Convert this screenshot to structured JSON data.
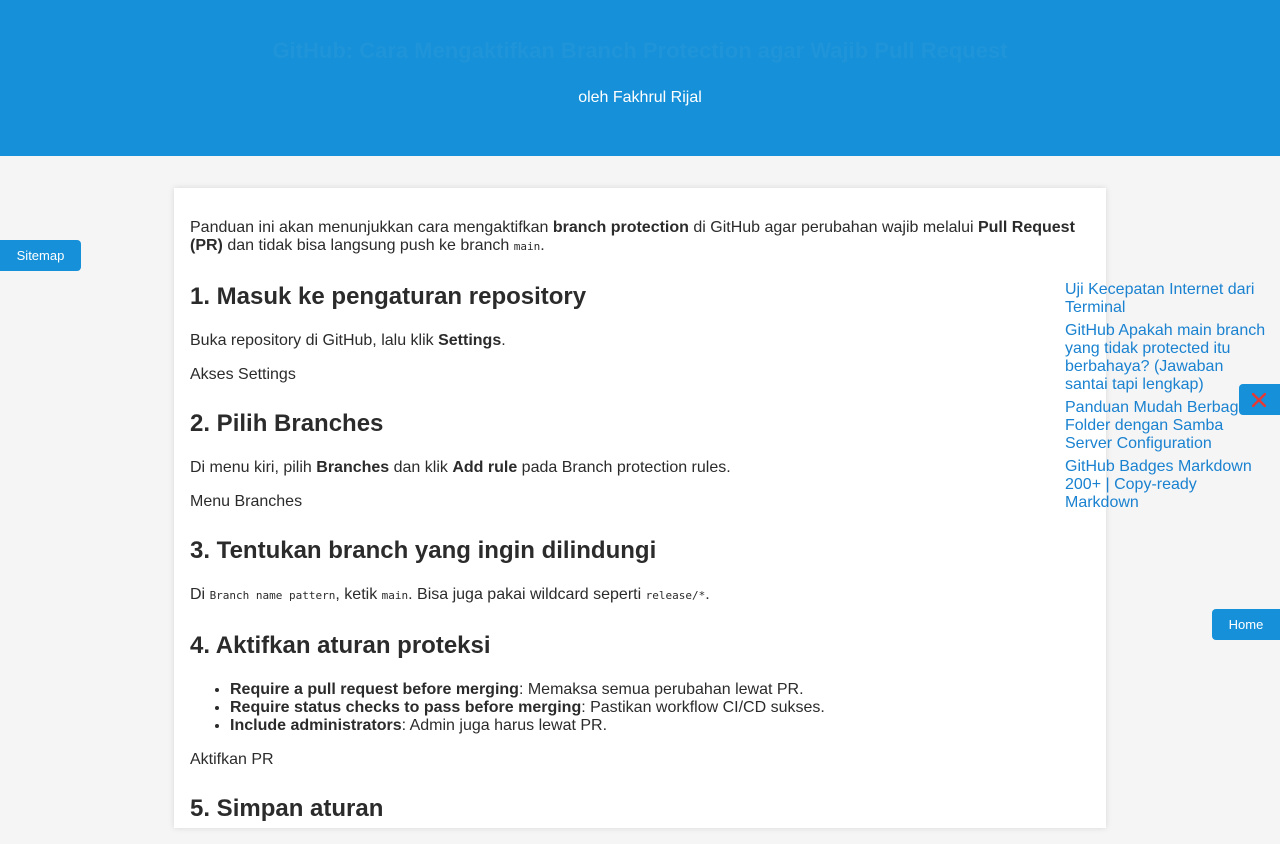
{
  "header": {
    "title": "GitHub: Cara Mengaktifkan Branch Protection agar Wajib Pull Request",
    "author": "oleh Fakhrul Rijal"
  },
  "nav": {
    "sitemap_label": "Sitemap",
    "home_label": "Home"
  },
  "article": {
    "intro": {
      "t1": "Panduan ini akan menunjukkan cara mengaktifkan ",
      "b1": "branch protection",
      "t2": " di GitHub agar perubahan wajib melalui ",
      "b2": "Pull Request (PR)",
      "t3": " dan tidak bisa langsung push ke branch ",
      "c1": "main",
      "t4": "."
    },
    "s1": {
      "heading": "1. Masuk ke pengaturan repository",
      "t1": "Buka repository di GitHub, lalu klik ",
      "b1": "Settings",
      "t2": ".",
      "img_alt": "Akses Settings"
    },
    "s2": {
      "heading": "2. Pilih Branches",
      "t1": "Di menu kiri, pilih ",
      "b1": "Branches",
      "t2": " dan klik ",
      "b2": "Add rule",
      "t3": " pada Branch protection rules.",
      "img_alt": "Menu Branches"
    },
    "s3": {
      "heading": "3. Tentukan branch yang ingin dilindungi",
      "t1": "Di ",
      "c1": "Branch name pattern",
      "t2": ", ketik ",
      "c2": "main",
      "t3": ". Bisa juga pakai wildcard seperti ",
      "c3": "release/*",
      "t4": "."
    },
    "s4": {
      "heading": "4. Aktifkan aturan proteksi",
      "items": [
        {
          "b": "Require a pull request before merging",
          "t": ": Memaksa semua perubahan lewat PR."
        },
        {
          "b": "Require status checks to pass before merging",
          "t": ": Pastikan workflow CI/CD sukses."
        },
        {
          "b": "Include administrators",
          "t": ": Admin juga harus lewat PR."
        }
      ],
      "img_alt": "Aktifkan PR"
    },
    "s5": {
      "heading": "5. Simpan aturan"
    }
  },
  "related": [
    "Uji Kecepatan Internet dari Terminal",
    "GitHub Apakah main branch yang tidak protected itu berbahaya? (Jawaban santai tapi lengkap)",
    "Panduan Mudah Berbagi Folder dengan Samba Server Configuration",
    "GitHub Badges Markdown 200+ | Copy-ready Markdown"
  ],
  "icons": {
    "close": "close-icon"
  },
  "colors": {
    "header_bg": "#1690d8",
    "link": "#1a82d0",
    "close_x": "#e53935"
  }
}
